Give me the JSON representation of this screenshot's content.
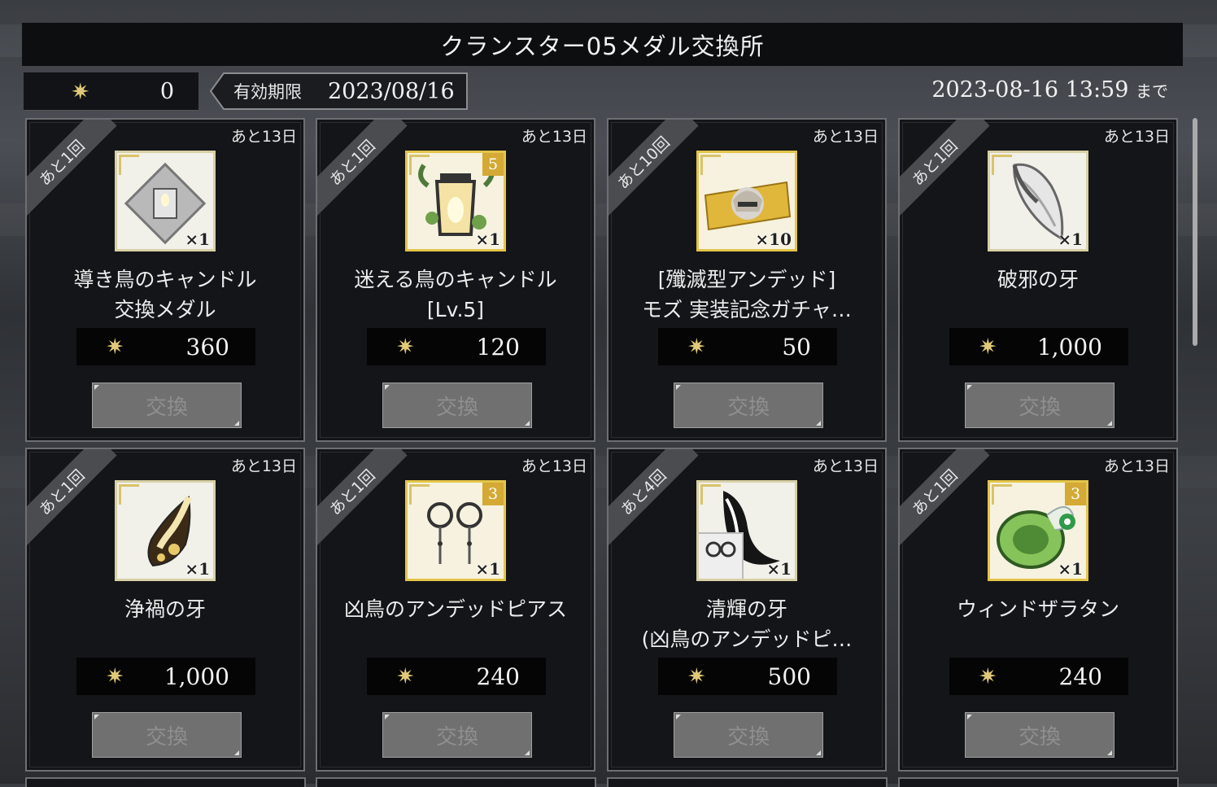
{
  "title": "クランスター05メダル交換所",
  "medal_count": "0",
  "deadline_label": "有効期限",
  "deadline_date": "2023/08/16",
  "until_time": "2023-08-16 13:59",
  "until_suffix": "まで",
  "star_symbol": "✷",
  "exchange_label": "交換",
  "items": [
    {
      "ribbon": "あと1回",
      "days": "あと13日",
      "name1": "導き鳥のキャンドル",
      "name2": "交換メダル",
      "price": "360",
      "qty": "×1",
      "level": "",
      "icon": "medal-icon",
      "frame": "plain"
    },
    {
      "ribbon": "あと1回",
      "days": "あと13日",
      "name1": "迷える鳥のキャンドル",
      "name2": "[Lv.5]",
      "price": "120",
      "qty": "×1",
      "level": "5",
      "icon": "lantern-icon",
      "frame": "gold"
    },
    {
      "ribbon": "あと10回",
      "days": "あと13日",
      "name1": "[殲滅型アンデッド]",
      "name2": "モズ 実装記念ガチャ…",
      "price": "50",
      "qty": "×10",
      "level": "",
      "icon": "ticket-icon",
      "frame": "gold"
    },
    {
      "ribbon": "あと1回",
      "days": "あと13日",
      "name1": "破邪の牙",
      "name2": "",
      "price": "1,000",
      "qty": "×1",
      "level": "",
      "icon": "fang-white-icon",
      "frame": "plain"
    },
    {
      "ribbon": "あと1回",
      "days": "あと13日",
      "name1": "浄禍の牙",
      "name2": "",
      "price": "1,000",
      "qty": "×1",
      "level": "",
      "icon": "fang-gold-icon",
      "frame": "plain"
    },
    {
      "ribbon": "あと1回",
      "days": "あと13日",
      "name1": "凶鳥のアンデッドピアス",
      "name2": "",
      "price": "240",
      "qty": "×1",
      "level": "3",
      "icon": "earring-icon",
      "frame": "gold"
    },
    {
      "ribbon": "あと4回",
      "days": "あと13日",
      "name1": "清輝の牙",
      "name2": "(凶鳥のアンデッドピ…",
      "price": "500",
      "qty": "×1",
      "level": "",
      "icon": "fang-black-icon",
      "frame": "plain"
    },
    {
      "ribbon": "あと1回",
      "days": "あと13日",
      "name1": "ウィンドザラタン",
      "name2": "",
      "price": "240",
      "qty": "×1",
      "level": "3",
      "icon": "turtle-icon",
      "frame": "gold"
    }
  ]
}
